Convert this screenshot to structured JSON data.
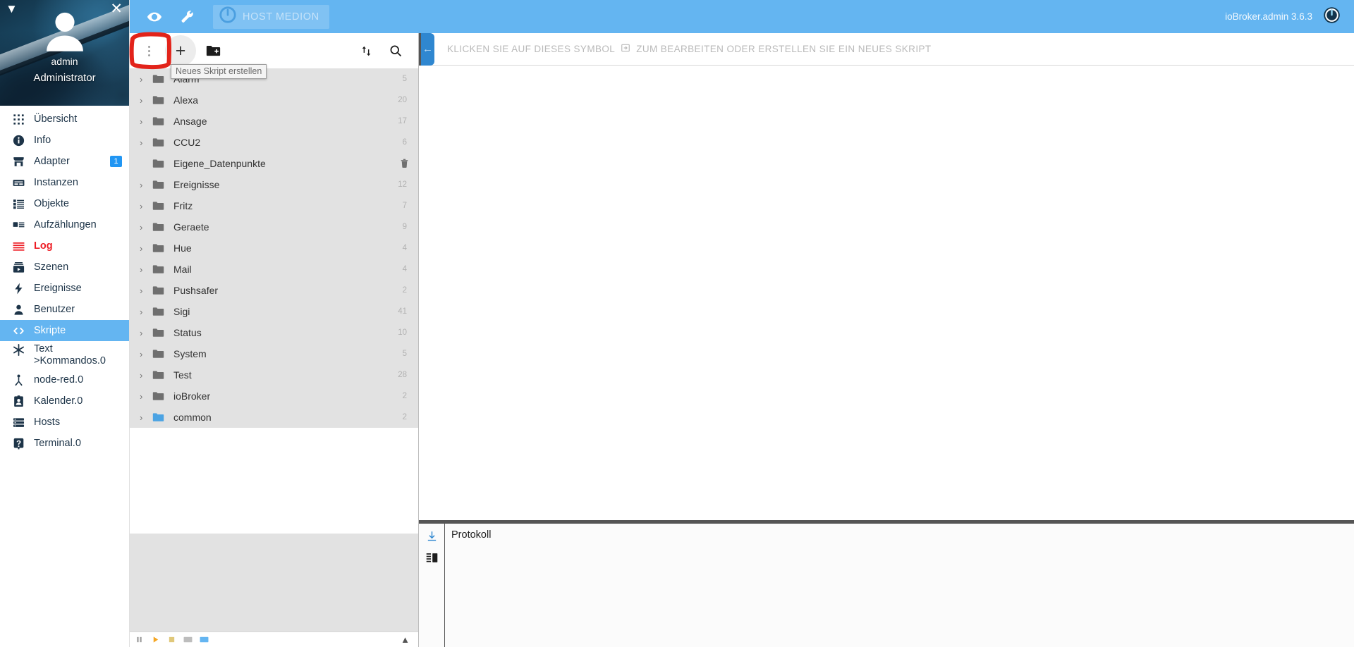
{
  "sidebar": {
    "collapse_icon": "triangle-down-icon",
    "close_icon": "close-icon",
    "username": "admin",
    "role": "Administrator",
    "items": [
      {
        "label": "Übersicht",
        "icon": "grid-icon",
        "state": "normal"
      },
      {
        "label": "Info",
        "icon": "info-icon",
        "state": "normal"
      },
      {
        "label": "Adapter",
        "icon": "store-icon",
        "state": "normal",
        "badge": "1"
      },
      {
        "label": "Instanzen",
        "icon": "instances-icon",
        "state": "normal"
      },
      {
        "label": "Objekte",
        "icon": "list-icon",
        "state": "normal"
      },
      {
        "label": "Aufzählungen",
        "icon": "enum-icon",
        "state": "normal"
      },
      {
        "label": "Log",
        "icon": "lines-icon",
        "state": "alert"
      },
      {
        "label": "Szenen",
        "icon": "scenes-icon",
        "state": "normal"
      },
      {
        "label": "Ereignisse",
        "icon": "bolt-icon",
        "state": "normal"
      },
      {
        "label": "Benutzer",
        "icon": "user-icon",
        "state": "normal"
      },
      {
        "label": "Skripte",
        "icon": "code-icon",
        "state": "active"
      },
      {
        "label": "Text->Kommandos.0",
        "icon": "snowflake-icon",
        "state": "normal",
        "two_line": true
      },
      {
        "label": "node-red.0",
        "icon": "node-red-icon",
        "state": "normal"
      },
      {
        "label": "Kalender.0",
        "icon": "calendar-icon",
        "state": "normal"
      },
      {
        "label": "Hosts",
        "icon": "server-icon",
        "state": "normal"
      },
      {
        "label": "Terminal.0",
        "icon": "question-icon",
        "state": "normal"
      }
    ]
  },
  "topbar": {
    "eye_icon": "eye-icon",
    "wrench_icon": "wrench-icon",
    "host_logo_icon": "iobroker-logo-icon",
    "host_label": "HOST MEDION",
    "version": "ioBroker.admin 3.6.3",
    "power_icon": "iobroker-power-icon",
    "accent_color": "#64b5f1"
  },
  "scripts_panel": {
    "menu_icon": "more-vertical-icon",
    "add_script_label": "+",
    "add_script_icon": "plus-icon",
    "add_folder_icon": "folder-plus-icon",
    "sort_icon": "sort-arrows-icon",
    "search_icon": "search-icon",
    "tooltip": "Neues Skript erstellen",
    "annotation": {
      "shape": "hand-drawn-rectangle",
      "color": "#e2231a"
    },
    "folders": [
      {
        "name": "Alarm",
        "count": "5",
        "expandable": true,
        "color": "gray"
      },
      {
        "name": "Alexa",
        "count": "20",
        "expandable": true,
        "color": "gray"
      },
      {
        "name": "Ansage",
        "count": "17",
        "expandable": true,
        "color": "gray"
      },
      {
        "name": "CCU2",
        "count": "6",
        "expandable": true,
        "color": "gray"
      },
      {
        "name": "Eigene_Datenpunkte",
        "count": "",
        "expandable": false,
        "color": "gray",
        "trash": true
      },
      {
        "name": "Ereignisse",
        "count": "12",
        "expandable": true,
        "color": "gray"
      },
      {
        "name": "Fritz",
        "count": "7",
        "expandable": true,
        "color": "gray"
      },
      {
        "name": "Geraete",
        "count": "9",
        "expandable": true,
        "color": "gray"
      },
      {
        "name": "Hue",
        "count": "4",
        "expandable": true,
        "color": "gray"
      },
      {
        "name": "Mail",
        "count": "4",
        "expandable": true,
        "color": "gray"
      },
      {
        "name": "Pushsafer",
        "count": "2",
        "expandable": true,
        "color": "gray"
      },
      {
        "name": "Sigi",
        "count": "41",
        "expandable": true,
        "color": "gray"
      },
      {
        "name": "Status",
        "count": "10",
        "expandable": true,
        "color": "gray"
      },
      {
        "name": "System",
        "count": "5",
        "expandable": true,
        "color": "gray"
      },
      {
        "name": "Test",
        "count": "28",
        "expandable": true,
        "color": "gray"
      },
      {
        "name": "ioBroker",
        "count": "2",
        "expandable": true,
        "color": "gray"
      },
      {
        "name": "common",
        "count": "2",
        "expandable": true,
        "color": "blue"
      }
    ],
    "footer": {
      "pause_icon": "pause-icon",
      "play_icon": "play-icon",
      "stop_icon": "stop-icon",
      "export_icon": "export-icon",
      "import_icon": "import-icon",
      "expand_icon": "chevron-up-icon"
    }
  },
  "editor": {
    "back_icon": "arrow-left-icon",
    "hint_prefix": "KLICKEN SIE AUF DIESES SYMBOL",
    "hint_icon": "open-in-icon",
    "hint_suffix": "ZUM BEARBEITEN ODER ERSTELLEN SIE EIN NEUES SKRIPT"
  },
  "log": {
    "download_icon": "download-icon",
    "layout_icon": "panel-layout-icon",
    "title": "Protokoll"
  }
}
